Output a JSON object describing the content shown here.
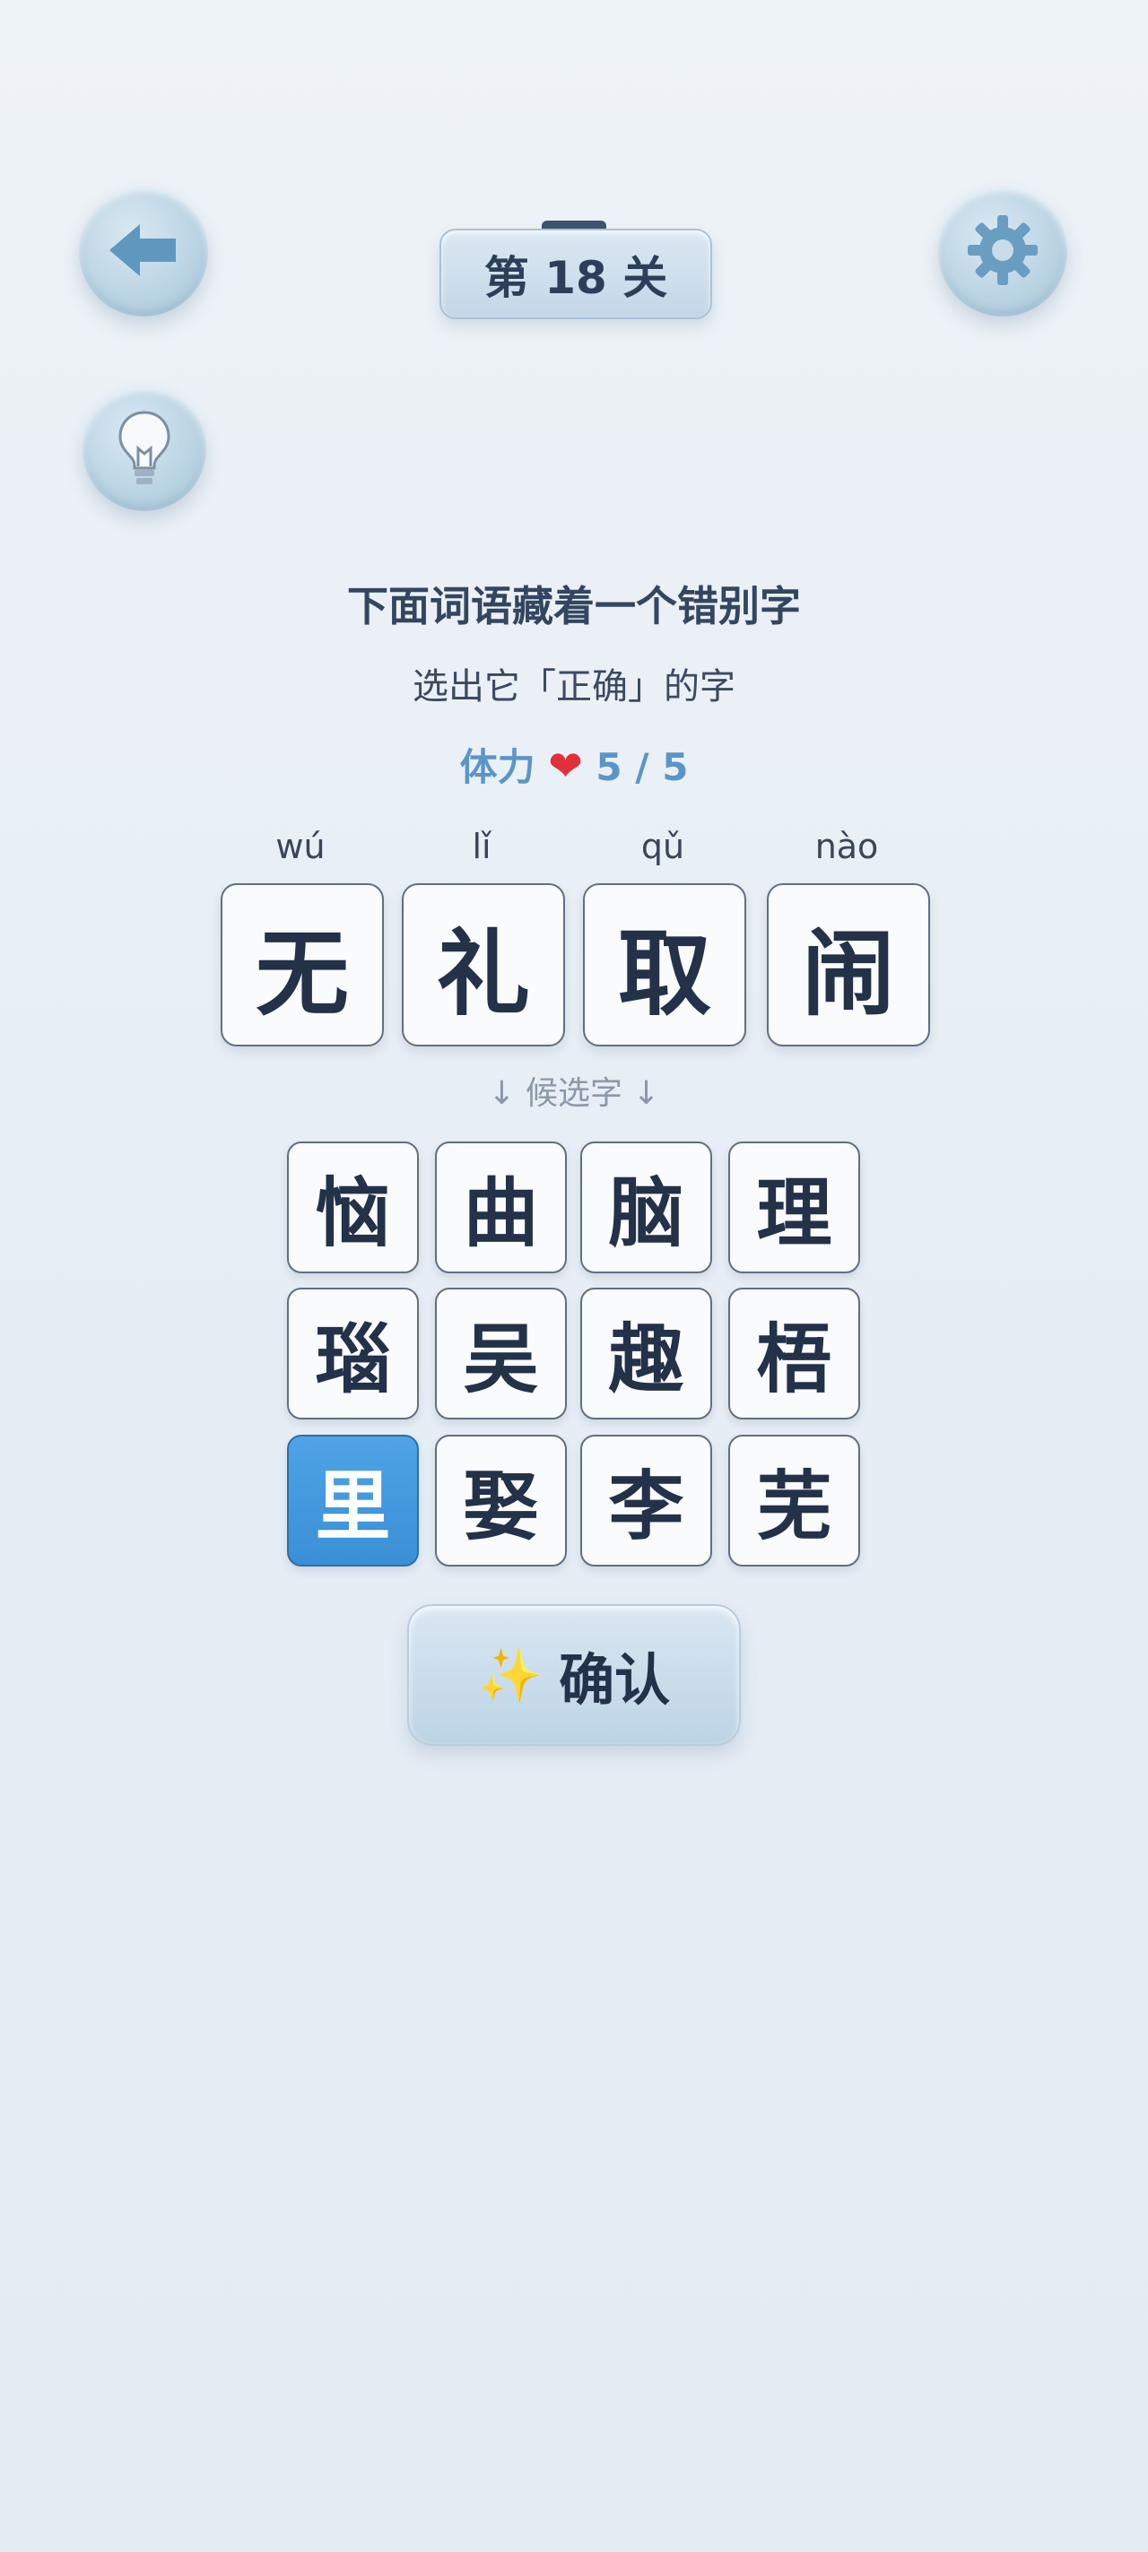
{
  "level": {
    "label": "第 18 关"
  },
  "instructions": {
    "title": "下面词语藏着一个错别字",
    "subtitle": "选出它「正确」的字"
  },
  "stamina": {
    "label": "体力",
    "heart": "❤",
    "value": "5 / 5"
  },
  "word": [
    {
      "pinyin": "wú",
      "char": "无"
    },
    {
      "pinyin": "lǐ",
      "char": "礼"
    },
    {
      "pinyin": "qǔ",
      "char": "取"
    },
    {
      "pinyin": "nào",
      "char": "闹"
    }
  ],
  "candidates_label": "↓ 候选字 ↓",
  "candidates": [
    [
      "恼",
      "曲",
      "脑",
      "理"
    ],
    [
      "瑙",
      "吴",
      "趣",
      "梧"
    ],
    [
      "里",
      "娶",
      "李",
      "芜"
    ]
  ],
  "selected_candidate": "里",
  "confirm": {
    "icon": "✨",
    "label": "确认"
  },
  "icons": {
    "back": "arrow-left-icon",
    "settings": "gear-icon",
    "hint": "lightbulb-icon"
  },
  "colors": {
    "accent": "#3a8fd6",
    "heart": "#e0303a",
    "stamina_text": "#5b95c8"
  }
}
